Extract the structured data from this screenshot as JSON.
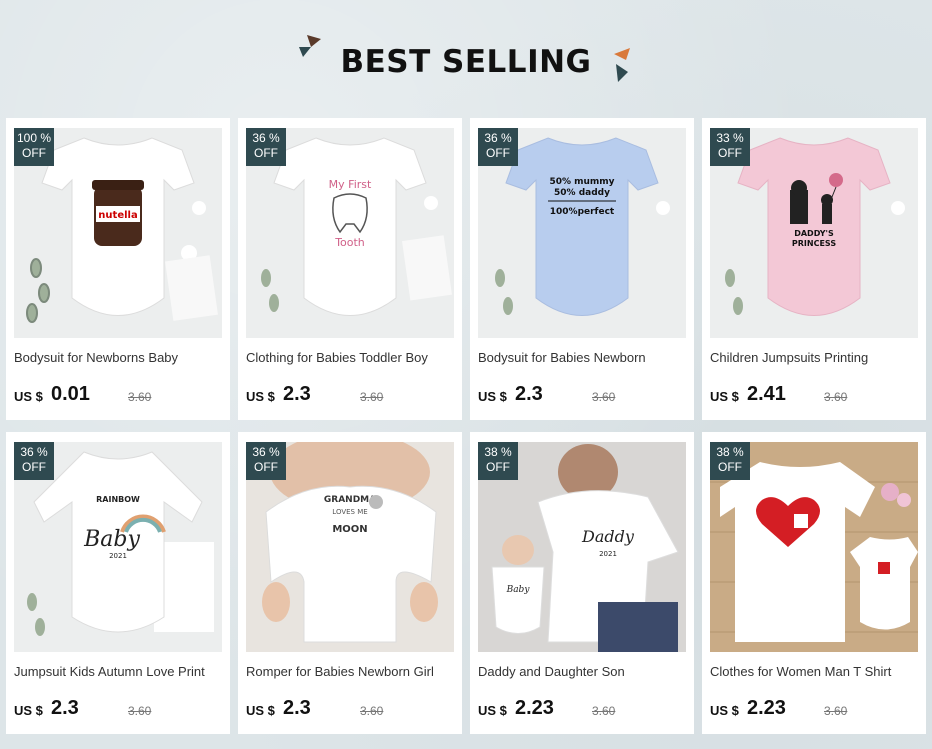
{
  "header": {
    "title": "BEST SELLING"
  },
  "products": [
    {
      "discount_pct": "100 %",
      "discount_off": "OFF",
      "name": "Bodysuit for Newborns Baby",
      "currency": "US $",
      "price": "0.01",
      "original_price": "3.60",
      "print_text": "nutella",
      "icon": "nutella-jar-onesie"
    },
    {
      "discount_pct": "36 %",
      "discount_off": "OFF",
      "name": "Clothing for Babies Toddler Boy",
      "currency": "US $",
      "price": "2.3",
      "original_price": "3.60",
      "print_text": "My First Tooth",
      "icon": "tooth-onesie"
    },
    {
      "discount_pct": "36 %",
      "discount_off": "OFF",
      "name": "Bodysuit for Babies Newborn",
      "currency": "US $",
      "price": "2.3",
      "original_price": "3.60",
      "print_text": "50% mummy 50% daddy 100%perfect",
      "icon": "blue-onesie"
    },
    {
      "discount_pct": "33 %",
      "discount_off": "OFF",
      "name": "Children Jumpsuits Printing",
      "currency": "US $",
      "price": "2.41",
      "original_price": "3.60",
      "print_text": "DADDY'S PRINCESS",
      "icon": "pink-onesie"
    },
    {
      "discount_pct": "36 %",
      "discount_off": "OFF",
      "name": "Jumpsuit Kids Autumn Love Print",
      "currency": "US $",
      "price": "2.3",
      "original_price": "3.60",
      "print_text": "RAINBOW Baby 2021",
      "icon": "rainbow-onesie"
    },
    {
      "discount_pct": "36 %",
      "discount_off": "OFF",
      "name": "Romper for Babies Newborn Girl",
      "currency": "US $",
      "price": "2.3",
      "original_price": "3.60",
      "print_text": "MY GRANDMA LOVES ME TO THE MOON AND BACK",
      "icon": "baby-photo"
    },
    {
      "discount_pct": "38 %",
      "discount_off": "OFF",
      "name": "Daddy and Daughter Son",
      "currency": "US $",
      "price": "2.23",
      "original_price": "3.60",
      "print_text": "Daddy 2021",
      "icon": "dad-baby-photo"
    },
    {
      "discount_pct": "38 %",
      "discount_off": "OFF",
      "name": "Clothes for Women Man T Shirt",
      "currency": "US $",
      "price": "2.23",
      "original_price": "3.60",
      "print_text": "",
      "icon": "heart-puzzle-shirts"
    }
  ]
}
